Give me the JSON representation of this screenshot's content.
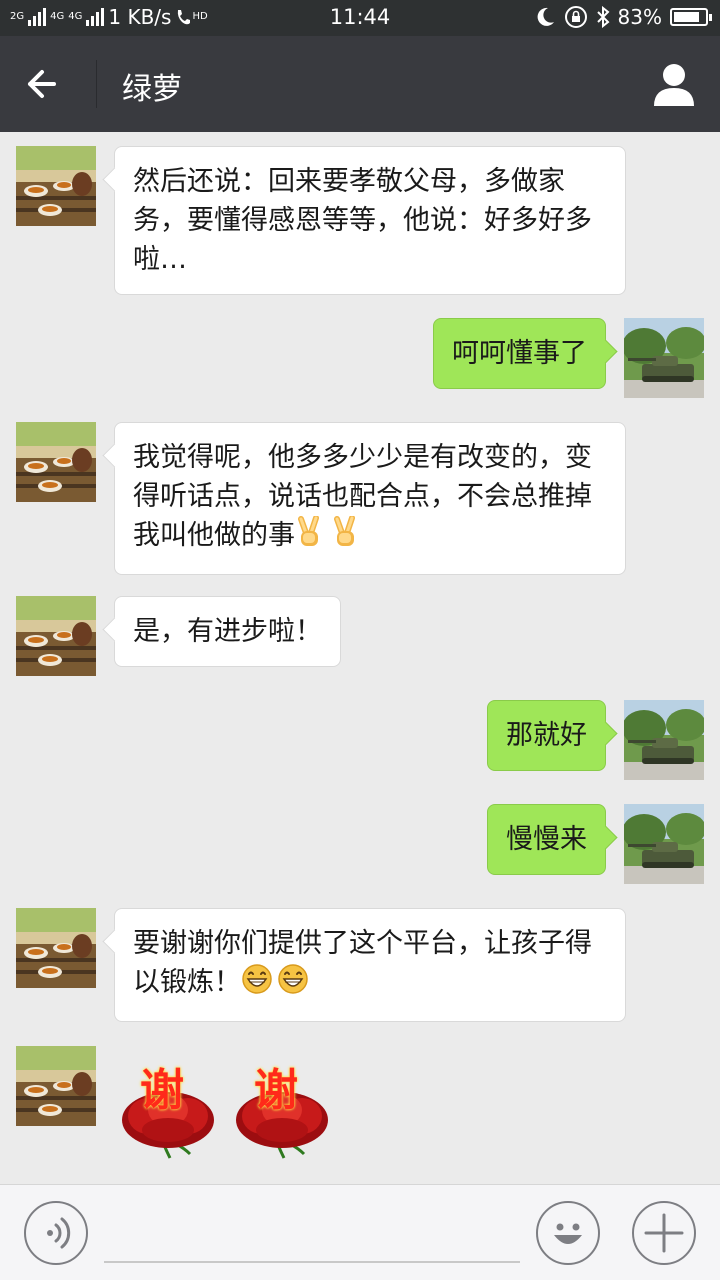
{
  "status_bar": {
    "net_2g": "2G",
    "net_4g_a": "4G",
    "net_4g_b": "4G",
    "speed": "1 KB/s",
    "hd": "HD",
    "time": "11:44",
    "battery": "83%",
    "battery_level": 0.83,
    "icons": [
      "signal-icon",
      "hd-call-icon",
      "moon-icon",
      "rotation-lock-icon",
      "bluetooth-icon",
      "battery-icon"
    ]
  },
  "header": {
    "title": "绿萝",
    "back_icon": "arrow-left-icon",
    "profile_icon": "person-icon"
  },
  "messages": [
    {
      "side": "left",
      "avatar": "tea-set",
      "text": "然后还说：回来要孝敬父母，多做家务，要懂得感恩等等，他说：好多好多啦…"
    },
    {
      "side": "right",
      "avatar": "tank",
      "text": "呵呵懂事了"
    },
    {
      "side": "left",
      "avatar": "tea-set",
      "text": "我觉得呢，他多多少少是有改变的，变得听话点，说话也配合点，不会总推掉我叫他做的事",
      "emoji": [
        "victory-hand",
        "victory-hand"
      ]
    },
    {
      "side": "left",
      "avatar": "tea-set",
      "text": "是，有进步啦！"
    },
    {
      "side": "right",
      "avatar": "tank",
      "text": "那就好"
    },
    {
      "side": "right",
      "avatar": "tank",
      "text": "慢慢来"
    },
    {
      "side": "left",
      "avatar": "tea-set",
      "text": "要谢谢你们提供了这个平台，让孩子得以锻炼！",
      "emoji": [
        "grin",
        "grin"
      ]
    },
    {
      "side": "left",
      "avatar": "tea-set",
      "sticker": "谢"
    }
  ],
  "input_bar": {
    "voice_icon": "voice-input-icon",
    "emoji_icon": "smiley-icon",
    "plus_icon": "plus-icon"
  }
}
